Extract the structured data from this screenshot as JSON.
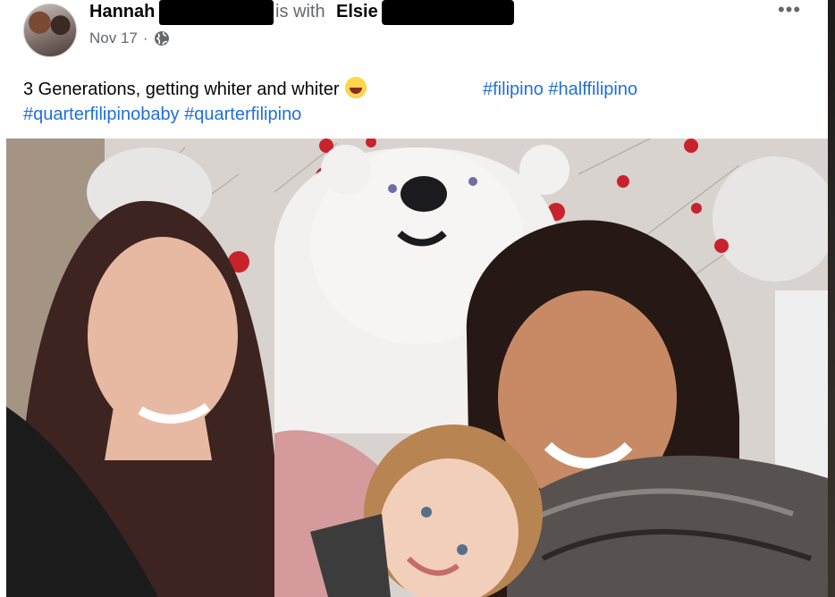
{
  "post": {
    "author_name": "Hannah",
    "with_text": "is with",
    "tagged_name": "Elsie",
    "date": "Nov 17",
    "separator": "·",
    "privacy_icon": "globe-icon",
    "more_label": "•••"
  },
  "caption": {
    "text": "3 Generations, getting whiter and whiter",
    "emoji": "laughing-tears-emoji",
    "hashtags_line1": "#filipino #halffilipino",
    "hashtags_line2": "#quarterfilipinobaby #quarterfilipino"
  },
  "colors": {
    "hashtag": "#216fdb",
    "secondary_text": "#65676b",
    "redaction": "#000000"
  }
}
